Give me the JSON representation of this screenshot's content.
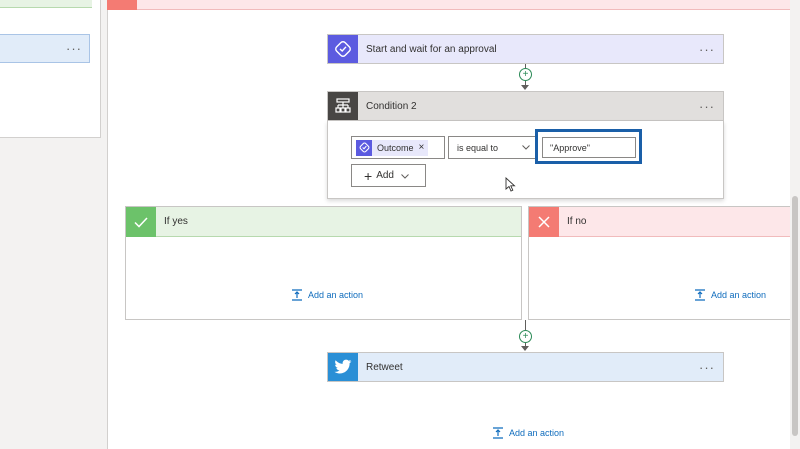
{
  "approval_action": {
    "title": "Start and wait for an approval",
    "more": "···"
  },
  "condition": {
    "title": "Condition 2",
    "more": "···",
    "operand_token": "Outcome",
    "token_remove": "×",
    "operator": "is equal to",
    "value": "\"Approve\"",
    "add_label": "Add"
  },
  "branches": {
    "yes": {
      "title": "If yes",
      "add_action": "Add an action"
    },
    "no": {
      "title": "If no",
      "add_action": "Add an action"
    }
  },
  "retweet_action": {
    "title": "Retweet",
    "more": "···"
  },
  "bottom_add_action": "Add an action",
  "left_panel": {
    "more": "···"
  },
  "colors": {
    "approval": "#5c5be0",
    "condition": "#484644",
    "yes": "#6cc26a",
    "no": "#f47b73",
    "twitter": "#2a8fd6",
    "highlight": "#1a5fa8",
    "link": "#0f6cbd"
  }
}
